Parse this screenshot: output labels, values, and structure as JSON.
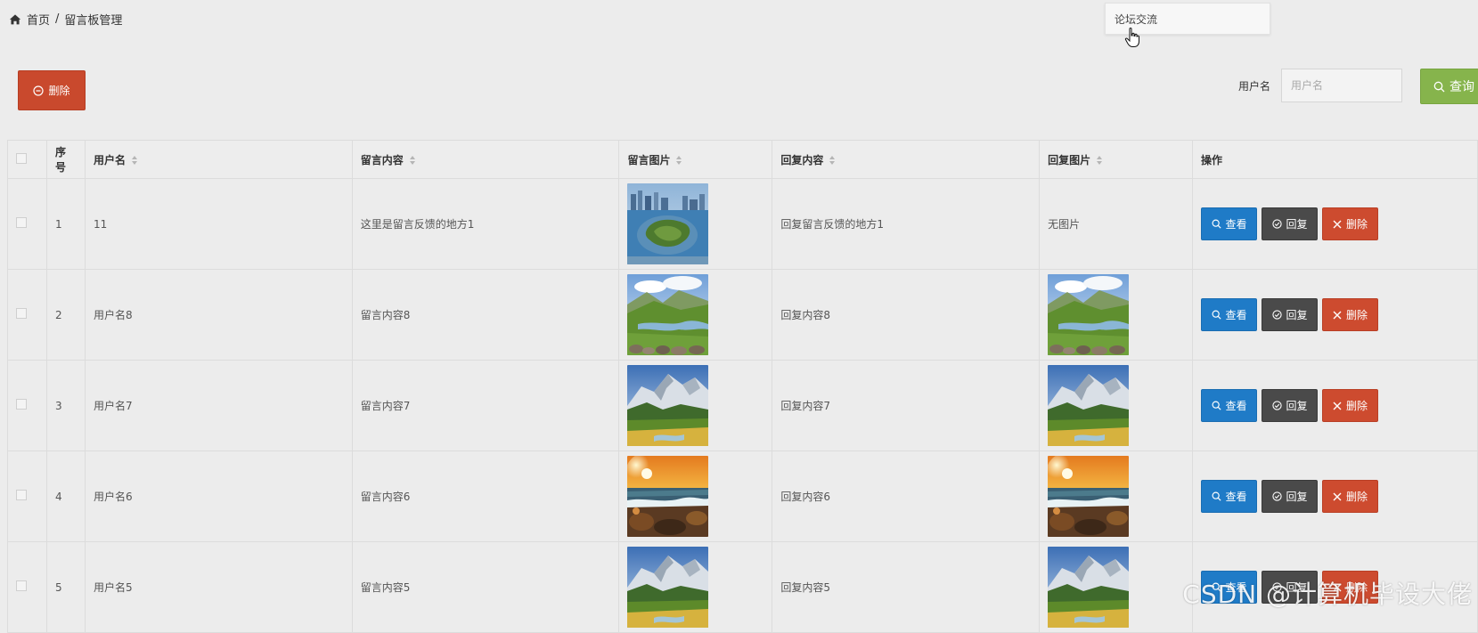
{
  "breadcrumb": {
    "home": "首页",
    "separator": "/",
    "current": "留言板管理"
  },
  "dropdown": {
    "item": "论坛交流"
  },
  "toolbar": {
    "delete_label": "删除"
  },
  "search": {
    "label": "用户名",
    "placeholder": "用户名",
    "button_label": "查询"
  },
  "table": {
    "headers": {
      "index": "序号",
      "username": "用户名",
      "content": "留言内容",
      "image": "留言图片",
      "reply": "回复内容",
      "reply_image": "回复图片",
      "ops": "操作"
    },
    "rows": [
      {
        "index": "1",
        "username": "11",
        "content": "这里是留言反馈的地方1",
        "image": "city-lake-photo",
        "reply": "回复留言反馈的地方1",
        "reply_image_text": "无图片",
        "reply_image": ""
      },
      {
        "index": "2",
        "username": "用户名8",
        "content": "留言内容8",
        "image": "mountain-valley-photo",
        "reply": "回复内容8",
        "reply_image_text": "",
        "reply_image": "mountain-valley-photo"
      },
      {
        "index": "3",
        "username": "用户名7",
        "content": "留言内容7",
        "image": "snow-mountain-photo",
        "reply": "回复内容7",
        "reply_image_text": "",
        "reply_image": "snow-mountain-photo"
      },
      {
        "index": "4",
        "username": "用户名6",
        "content": "留言内容6",
        "image": "sunset-sea-photo",
        "reply": "回复内容6",
        "reply_image_text": "",
        "reply_image": "sunset-sea-photo"
      },
      {
        "index": "5",
        "username": "用户名5",
        "content": "留言内容5",
        "image": "snow-mountain-photo",
        "reply": "回复内容5",
        "reply_image_text": "",
        "reply_image": "snow-mountain-photo"
      }
    ],
    "actions": {
      "view": "查看",
      "reply": "回复",
      "delete": "删除"
    }
  },
  "watermark": "CSDN @计算机毕设大佬",
  "colors": {
    "delete": "#c9492d",
    "view": "#1f7bc7",
    "reply": "#4a4a4a",
    "search": "#86b44c"
  }
}
